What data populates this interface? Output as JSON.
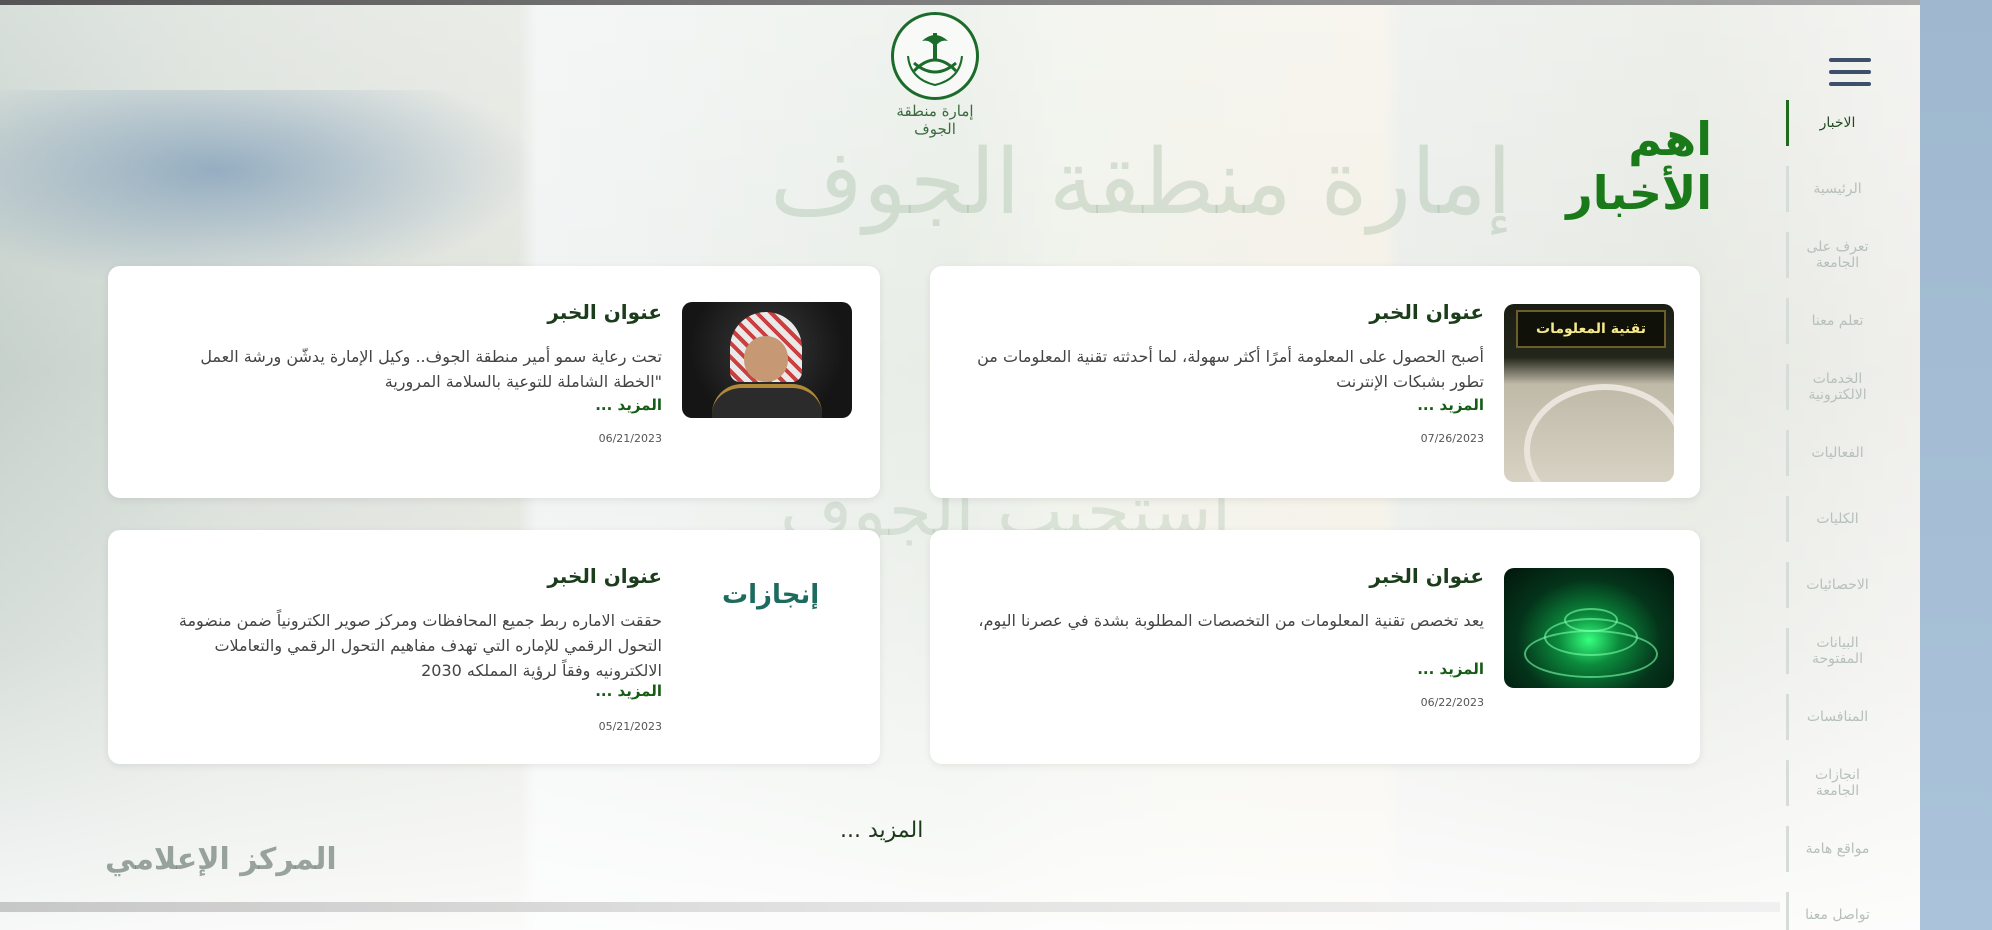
{
  "logo": {
    "text": "إمارة منطقة الجوف"
  },
  "watermarks": {
    "main": "إمارة منطقة الجوف",
    "secondary": "استجيب الجوف",
    "media_center": "المركز الإعلامي"
  },
  "page_title": "اهم الأخبار",
  "nav": {
    "items": [
      {
        "label": "الاخبار",
        "active": true
      },
      {
        "label": "الرئيسية"
      },
      {
        "label": "تعرف على الجامعة"
      },
      {
        "label": "تعلم معنا"
      },
      {
        "label": "الخدمات الالكترونية"
      },
      {
        "label": "الفعاليات"
      },
      {
        "label": "الكليات"
      },
      {
        "label": "الاحصائيات"
      },
      {
        "label": "البيانات المفتوحة"
      },
      {
        "label": "المنافسات"
      },
      {
        "label": "انجازات الجامعة"
      },
      {
        "label": "مواقع هامة"
      },
      {
        "label": "تواصل معنا"
      }
    ]
  },
  "news": [
    {
      "title": "عنوان الخبر",
      "desc": "أصبح الحصول على المعلومة أمرًا أكثر سهولة، لما أحدثته تقنية المعلومات من تطور بشبكات الإنترنت",
      "more": "المزيد ...",
      "date": "07/26/2023",
      "sign": "تقنية المعلومات"
    },
    {
      "title": "عنوان الخبر",
      "desc": "تحت رعاية سمو أمير منطقة الجوف.. وكيل الإمارة يدشّن ورشة العمل \"الخطة الشاملة للتوعية بالسلامة المرورية",
      "more": "المزيد ...",
      "date": "06/21/2023"
    },
    {
      "title": "عنوان الخبر",
      "desc": "يعد تخصص تقنية المعلومات من التخصصات المطلوبة بشدة في عصرنا اليوم،",
      "more": "المزيد ...",
      "date": "06/22/2023"
    },
    {
      "title": "عنوان الخبر",
      "desc": "حققت الاماره ربط جميع المحافظات ومركز صوير الكترونياً ضمن منضومة التحول الرقمي للإماره التي تهدف مفاهيم التحول الرقمي والتعاملات الالكترونيه وفقاً لرؤية المملكه 2030",
      "more": "المزيد ...",
      "date": "05/21/2023"
    }
  ],
  "achievements_label": "إنجازات",
  "more_link": "المزيد ..."
}
